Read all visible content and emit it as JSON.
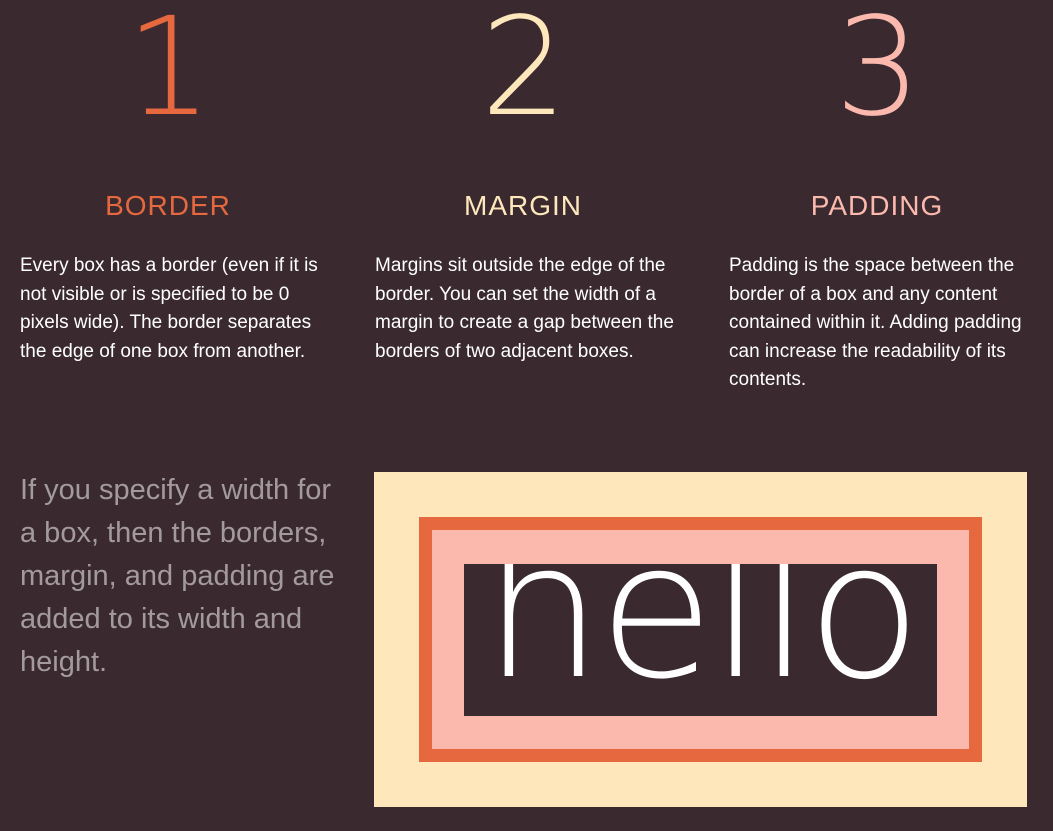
{
  "columns": [
    {
      "number": "1",
      "heading": "BORDER",
      "description": "Every box has a border (even if it is not visible or is specified to be 0 pixels wide). The border separates the edge of one box from another."
    },
    {
      "number": "2",
      "heading": "MARGIN",
      "description": "Margins sit outside the edge of the border. You can set the width of a margin to create a gap between the borders of two adjacent boxes."
    },
    {
      "number": "3",
      "heading": "PADDING",
      "description": "Padding is the space between the border of a box and any content contained within it. Adding padding can increase the readability of its contents."
    }
  ],
  "summary": "If you specify a width for a box, then the borders, margin, and padding are added to its width and height.",
  "diagram": {
    "content_text": "hello"
  },
  "colors": {
    "background": "#3a2a30",
    "border_accent": "#e5683f",
    "margin_accent": "#fde7bb",
    "padding_accent": "#fbb9ae",
    "summary_text": "#a39a9d"
  }
}
